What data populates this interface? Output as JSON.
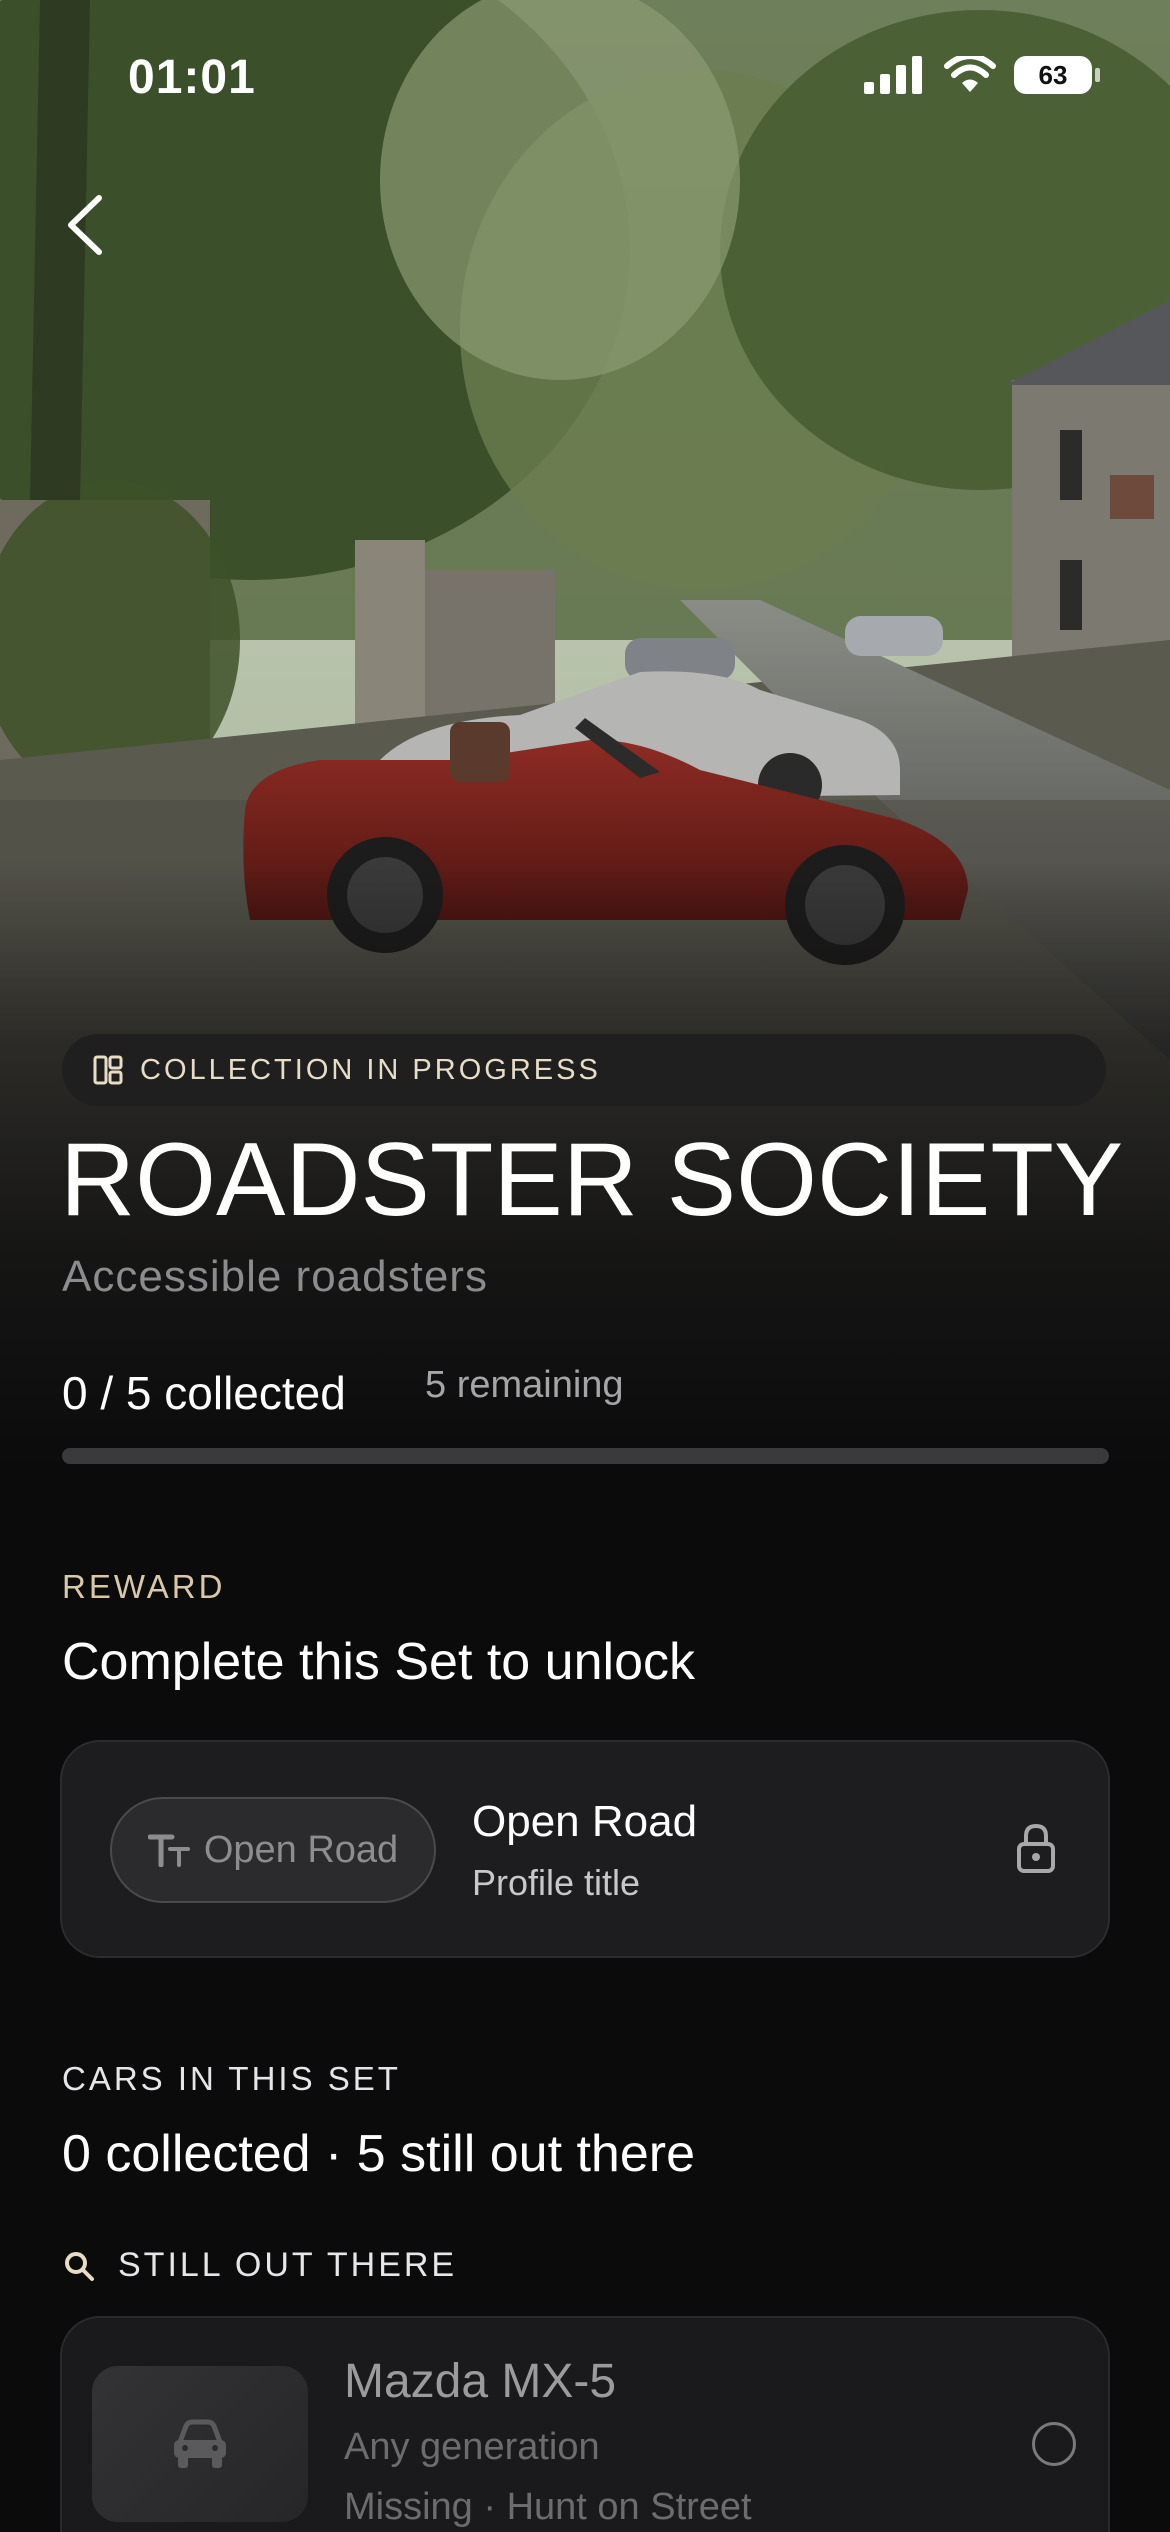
{
  "status_bar": {
    "time": "01:01",
    "battery": "63"
  },
  "collection": {
    "badge": "COLLECTION IN PROGRESS",
    "title": "ROADSTER SOCIETY",
    "subtitle": "Accessible roadsters",
    "collected_text": "0 / 5 collected",
    "remaining_text": "5 remaining",
    "progress": 0
  },
  "reward": {
    "section_label": "REWARD",
    "heading": "Complete this Set to unlock",
    "chip_label": "Open Road",
    "name": "Open Road",
    "type": "Profile title"
  },
  "cars": {
    "section_label": "CARS IN THIS SET",
    "heading": "0 collected · 5 still out there",
    "still_label": "STILL OUT THERE",
    "items": [
      {
        "name": "Mazda MX-5",
        "generation": "Any generation",
        "status": "Missing · Hunt on Street"
      }
    ]
  },
  "colors": {
    "accent": "#e8dcc6",
    "background": "#0b0b0c",
    "card": "#1d1d1f"
  },
  "icons": {
    "back": "chevron-left-icon",
    "badge": "collection-grid-icon",
    "chip": "text-style-icon",
    "lock": "lock-icon",
    "search": "search-icon",
    "car": "car-icon"
  }
}
